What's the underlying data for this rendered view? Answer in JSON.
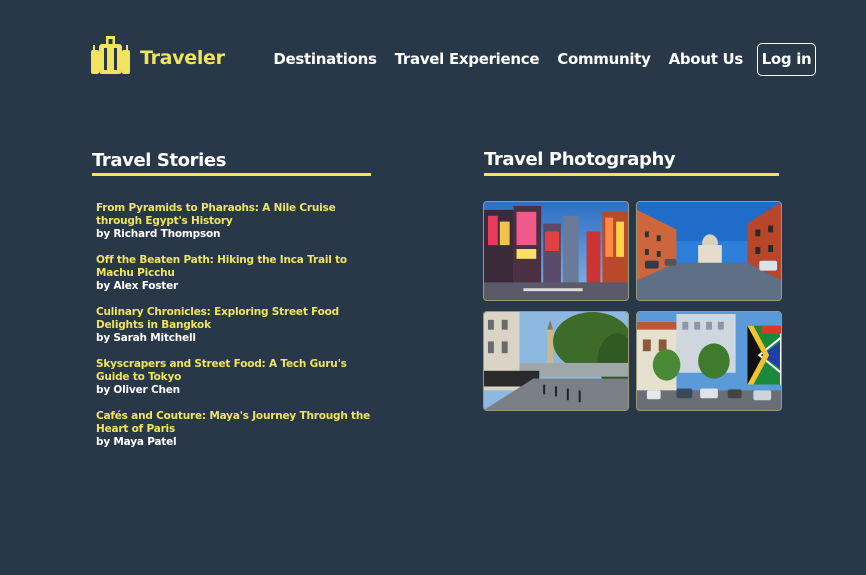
{
  "brand": {
    "name": "Traveler",
    "icon": "luggage-icon",
    "accent_color": "#f0e45e",
    "background_color": "#283849"
  },
  "nav": {
    "links": [
      "Destinations",
      "Travel Experience",
      "Community",
      "About Us"
    ],
    "login_label": "Log in"
  },
  "stories": {
    "heading": "Travel Stories",
    "items": [
      {
        "title": "From Pyramids to Pharaohs: A Nile Cruise through Egypt's History",
        "author": "by Richard Thompson"
      },
      {
        "title": "Off the Beaten Path: Hiking the Inca Trail to Machu Picchu",
        "author": "by Alex Foster"
      },
      {
        "title": "Culinary Chronicles: Exploring Street Food Delights in Bangkok",
        "author": "by Sarah Mitchell"
      },
      {
        "title": "Skyscrapers and Street Food: A Tech Guru's Guide to Tokyo",
        "author": "by Oliver Chen"
      },
      {
        "title": "Cafés and Couture: Maya's Journey Through the Heart of Paris",
        "author": "by Maya Patel"
      }
    ]
  },
  "photography": {
    "heading": "Travel Photography",
    "photos": [
      "tokyo-street-photo",
      "rome-street-photo",
      "london-street-photo",
      "south-africa-street-photo"
    ]
  }
}
